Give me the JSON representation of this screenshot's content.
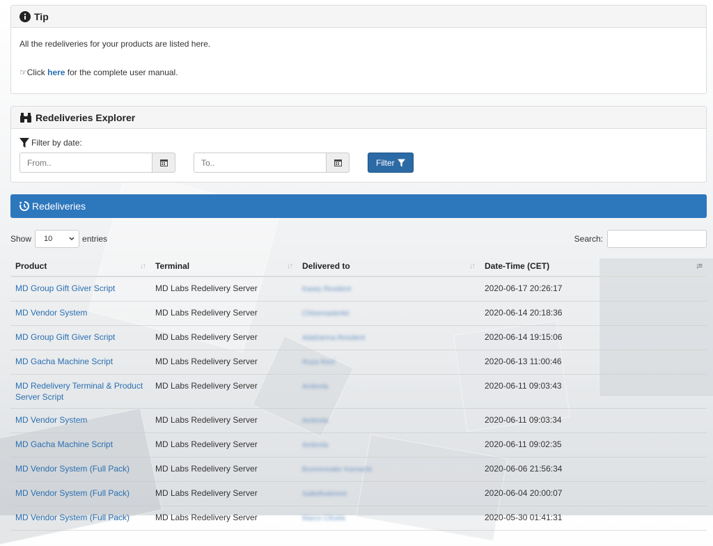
{
  "tip": {
    "title": "Tip",
    "line1": "All the redeliveries for your products are listed here.",
    "line2_prefix": "Click ",
    "line2_link": "here",
    "line2_suffix": " for the complete user manual."
  },
  "explorer": {
    "title": "Redeliveries Explorer",
    "filter_label": "Filter by date:",
    "from_placeholder": "From..",
    "to_placeholder": "To..",
    "filter_button": "Filter"
  },
  "redeliveries": {
    "title": "Redeliveries",
    "show_label": "Show",
    "entries_value": "10",
    "entries_label": "entries",
    "search_label": "Search:",
    "columns": [
      "Product",
      "Terminal",
      "Delivered to",
      "Date-Time (CET)"
    ],
    "rows": [
      {
        "product": "MD Group Gift Giver Script",
        "terminal": "MD Labs Redelivery Server",
        "delivered": "Kasey Resident",
        "datetime": "2020-06-17 20:26:17"
      },
      {
        "product": "MD Vendor System",
        "terminal": "MD Labs Redelivery Server",
        "delivered": "Chloemasterlet",
        "datetime": "2020-06-14 20:18:36"
      },
      {
        "product": "MD Group Gift Giver Script",
        "terminal": "MD Labs Redelivery Server",
        "delivered": "AdaDarma Resident",
        "datetime": "2020-06-14 19:15:06"
      },
      {
        "product": "MD Gacha Machine Script",
        "terminal": "MD Labs Redelivery Server",
        "delivered": "Roza Reel",
        "datetime": "2020-06-13 11:00:46"
      },
      {
        "product": "MD Redelivery Terminal & Product Server Script",
        "terminal": "MD Labs Redelivery Server",
        "delivered": "Ambrela",
        "datetime": "2020-06-11 09:03:43"
      },
      {
        "product": "MD Vendor System",
        "terminal": "MD Labs Redelivery Server",
        "delivered": "Ambrela",
        "datetime": "2020-06-11 09:03:34"
      },
      {
        "product": "MD Gacha Machine Script",
        "terminal": "MD Labs Redelivery Server",
        "delivered": "Ambrela",
        "datetime": "2020-06-11 09:02:35"
      },
      {
        "product": "MD Vendor System (Full Pack)",
        "terminal": "MD Labs Redelivery Server",
        "delivered": "Bonnevivaler Kamacht",
        "datetime": "2020-06-06 21:56:34"
      },
      {
        "product": "MD Vendor System (Full Pack)",
        "terminal": "MD Labs Redelivery Server",
        "delivered": "Isabellvalmont",
        "datetime": "2020-06-04 20:00:07"
      },
      {
        "product": "MD Vendor System (Full Pack)",
        "terminal": "MD Labs Redelivery Server",
        "delivered": "Marco Cifuela",
        "datetime": "2020-05-30 01:41:31"
      }
    ]
  },
  "colors": {
    "accent": "#2d77bd",
    "link": "#2a6fb0",
    "button": "#2c6aa5"
  }
}
